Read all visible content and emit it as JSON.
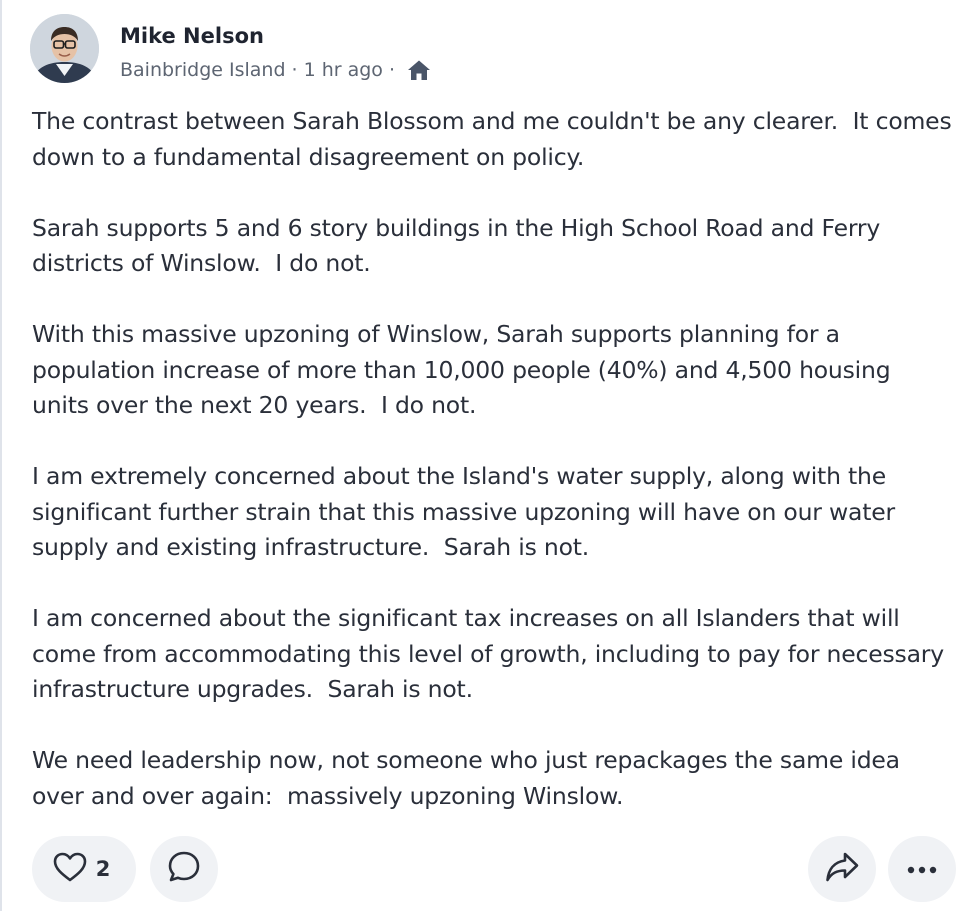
{
  "post": {
    "author": {
      "name": "Mike Nelson",
      "avatar_icon": "user-avatar-photo"
    },
    "meta": {
      "location": "Bainbridge Island",
      "separator": "·",
      "time": "1 hr ago",
      "visibility_icon": "home-icon"
    },
    "paragraphs": [
      "The contrast between Sarah Blossom and me couldn't be any clearer.  It comes down to a fundamental disagreement on policy.",
      "Sarah supports 5 and 6 story buildings in the High School Road and Ferry districts of Winslow.  I do not.",
      "With this massive upzoning of Winslow, Sarah supports planning for a population increase of more than 10,000 people (40%) and 4,500 housing units over the next 20 years.  I do not.",
      "I am extremely concerned about the Island's water supply, along with the significant further strain that this massive upzoning will have on our water supply and existing infrastructure.  Sarah is not.",
      "I am concerned about the significant tax increases on all Islanders that will come from accommodating this level of growth, including to pay for necessary infrastructure upgrades.  Sarah is not.",
      "We need leadership now, not someone who just repackages the same idea over and over again:  massively upzoning Winslow."
    ],
    "actions": {
      "like_icon": "heart-icon",
      "like_count": "2",
      "comment_icon": "comment-bubble-icon",
      "share_icon": "share-arrow-icon",
      "more_icon": "more-dots-icon"
    },
    "colors": {
      "text": "#2a2f3a",
      "meta": "#5d6572",
      "pill_bg": "#f0f2f5",
      "icon": "#2a2f3a",
      "home_icon": "#4a5568"
    }
  }
}
